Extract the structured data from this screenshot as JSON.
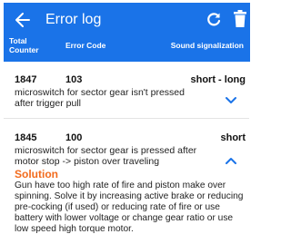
{
  "appbar": {
    "title": "Error log",
    "color": "#1a73e8",
    "back_icon": "arrow-left-icon",
    "refresh_icon": "refresh-icon",
    "delete_icon": "trash-icon"
  },
  "columns": {
    "total_counter": "Total Counter",
    "error_code": "Error Code",
    "sound_signalization": "Sound signalization"
  },
  "errors": [
    {
      "counter": "1847",
      "code": "103",
      "sound": "short - long",
      "description": "microswitch for sector gear isn't pressed after trigger pull",
      "expanded": false,
      "toggle_icon": "chevron-down-icon"
    },
    {
      "counter": "1845",
      "code": "100",
      "sound": "short",
      "description": "microswitch for sector gear is pressed after motor stop -> piston over traveling",
      "expanded": true,
      "toggle_icon": "chevron-up-icon",
      "solution_title": "Solution",
      "solution_text": "Gun have too high rate of fire and piston make over spinning. Solve it by increasing active brake or reducing pre-cocking (if used) or reducing rate of fire or use battery with lower voltage or change gear ratio or use low speed high torque motor."
    }
  ],
  "colors": {
    "accent": "#1a73e8",
    "solution": "#f26b1d"
  }
}
